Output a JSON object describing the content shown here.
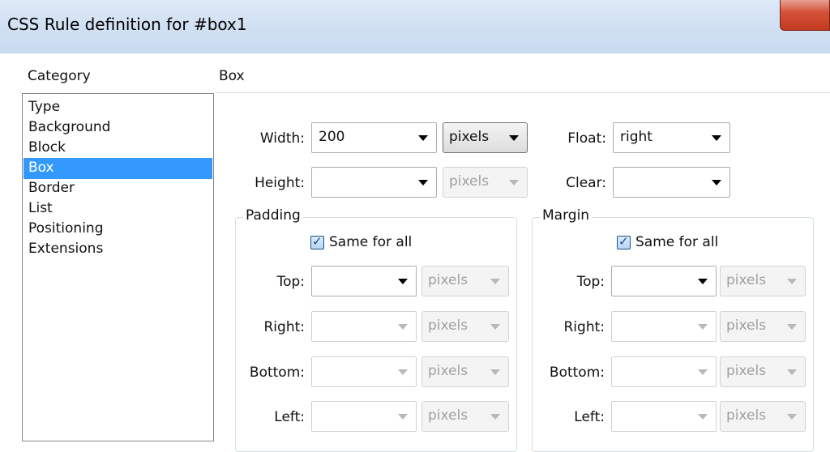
{
  "window": {
    "title": "CSS Rule definition for #box1"
  },
  "category": {
    "header": "Category",
    "items": [
      {
        "label": "Type"
      },
      {
        "label": "Background"
      },
      {
        "label": "Block"
      },
      {
        "label": "Box",
        "selected": true
      },
      {
        "label": "Border"
      },
      {
        "label": "List"
      },
      {
        "label": "Positioning"
      },
      {
        "label": "Extensions"
      }
    ]
  },
  "panel": {
    "title": "Box",
    "width": {
      "label": "Width:",
      "value": "200",
      "unit": "pixels"
    },
    "height": {
      "label": "Height:",
      "value": "",
      "unit": "pixels"
    },
    "float": {
      "label": "Float:",
      "value": "right"
    },
    "clear": {
      "label": "Clear:",
      "value": ""
    },
    "padding": {
      "title": "Padding",
      "same_for_all": "Same for all",
      "top": {
        "label": "Top:",
        "value": "",
        "unit": "pixels"
      },
      "right": {
        "label": "Right:",
        "value": "",
        "unit": "pixels"
      },
      "bottom": {
        "label": "Bottom:",
        "value": "",
        "unit": "pixels"
      },
      "left": {
        "label": "Left:",
        "value": "",
        "unit": "pixels"
      }
    },
    "margin": {
      "title": "Margin",
      "same_for_all": "Same for all",
      "top": {
        "label": "Top:",
        "value": "",
        "unit": "pixels"
      },
      "right": {
        "label": "Right:",
        "value": "",
        "unit": "pixels"
      },
      "bottom": {
        "label": "Bottom:",
        "value": "",
        "unit": "pixels"
      },
      "left": {
        "label": "Left:",
        "value": "",
        "unit": "pixels"
      }
    }
  },
  "colors": {
    "selection": "#3399ff",
    "titlebar": "#d2e1f3",
    "close": "#c2391f"
  }
}
